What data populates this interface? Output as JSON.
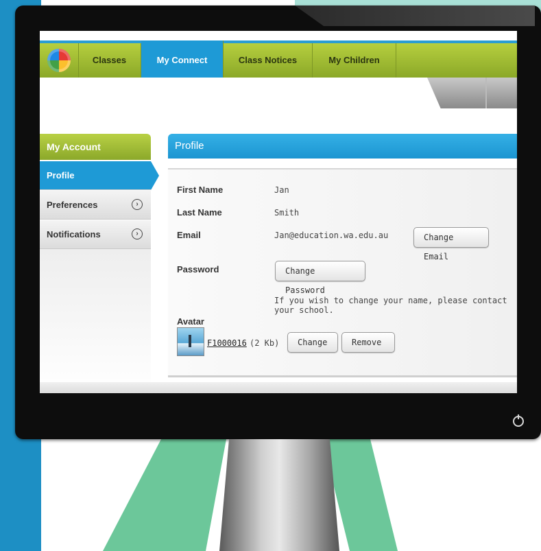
{
  "nav": {
    "tabs": [
      {
        "label": "Classes"
      },
      {
        "label": "My Connect",
        "active": true
      },
      {
        "label": "Class Notices"
      },
      {
        "label": "My Children"
      }
    ]
  },
  "sidebar": {
    "header": "My Account",
    "items": [
      {
        "label": "Profile",
        "active": true
      },
      {
        "label": "Preferences",
        "icon": "chevron-right-circle-icon"
      },
      {
        "label": "Notifications",
        "icon": "chevron-right-circle-icon"
      }
    ]
  },
  "profile": {
    "title": "Profile",
    "first_name_label": "First Name",
    "first_name": "Jan",
    "last_name_label": "Last Name",
    "last_name": "Smith",
    "email_label": "Email",
    "email": "Jan@education.wa.edu.au",
    "change_email": "Change Email",
    "password_label": "Password",
    "change_password": "Change Password",
    "notice": "If you wish to change your name, please contact your school.",
    "avatar_label": "Avatar",
    "avatar_file": "F1000016",
    "avatar_size": "(2 Kb)",
    "change": "Change",
    "remove": "Remove"
  },
  "colors": {
    "nav_green": "#a3bd35",
    "accent_blue": "#1e9ad6",
    "background_blue": "#1d8fc4",
    "background_green": "#6cc79a"
  }
}
